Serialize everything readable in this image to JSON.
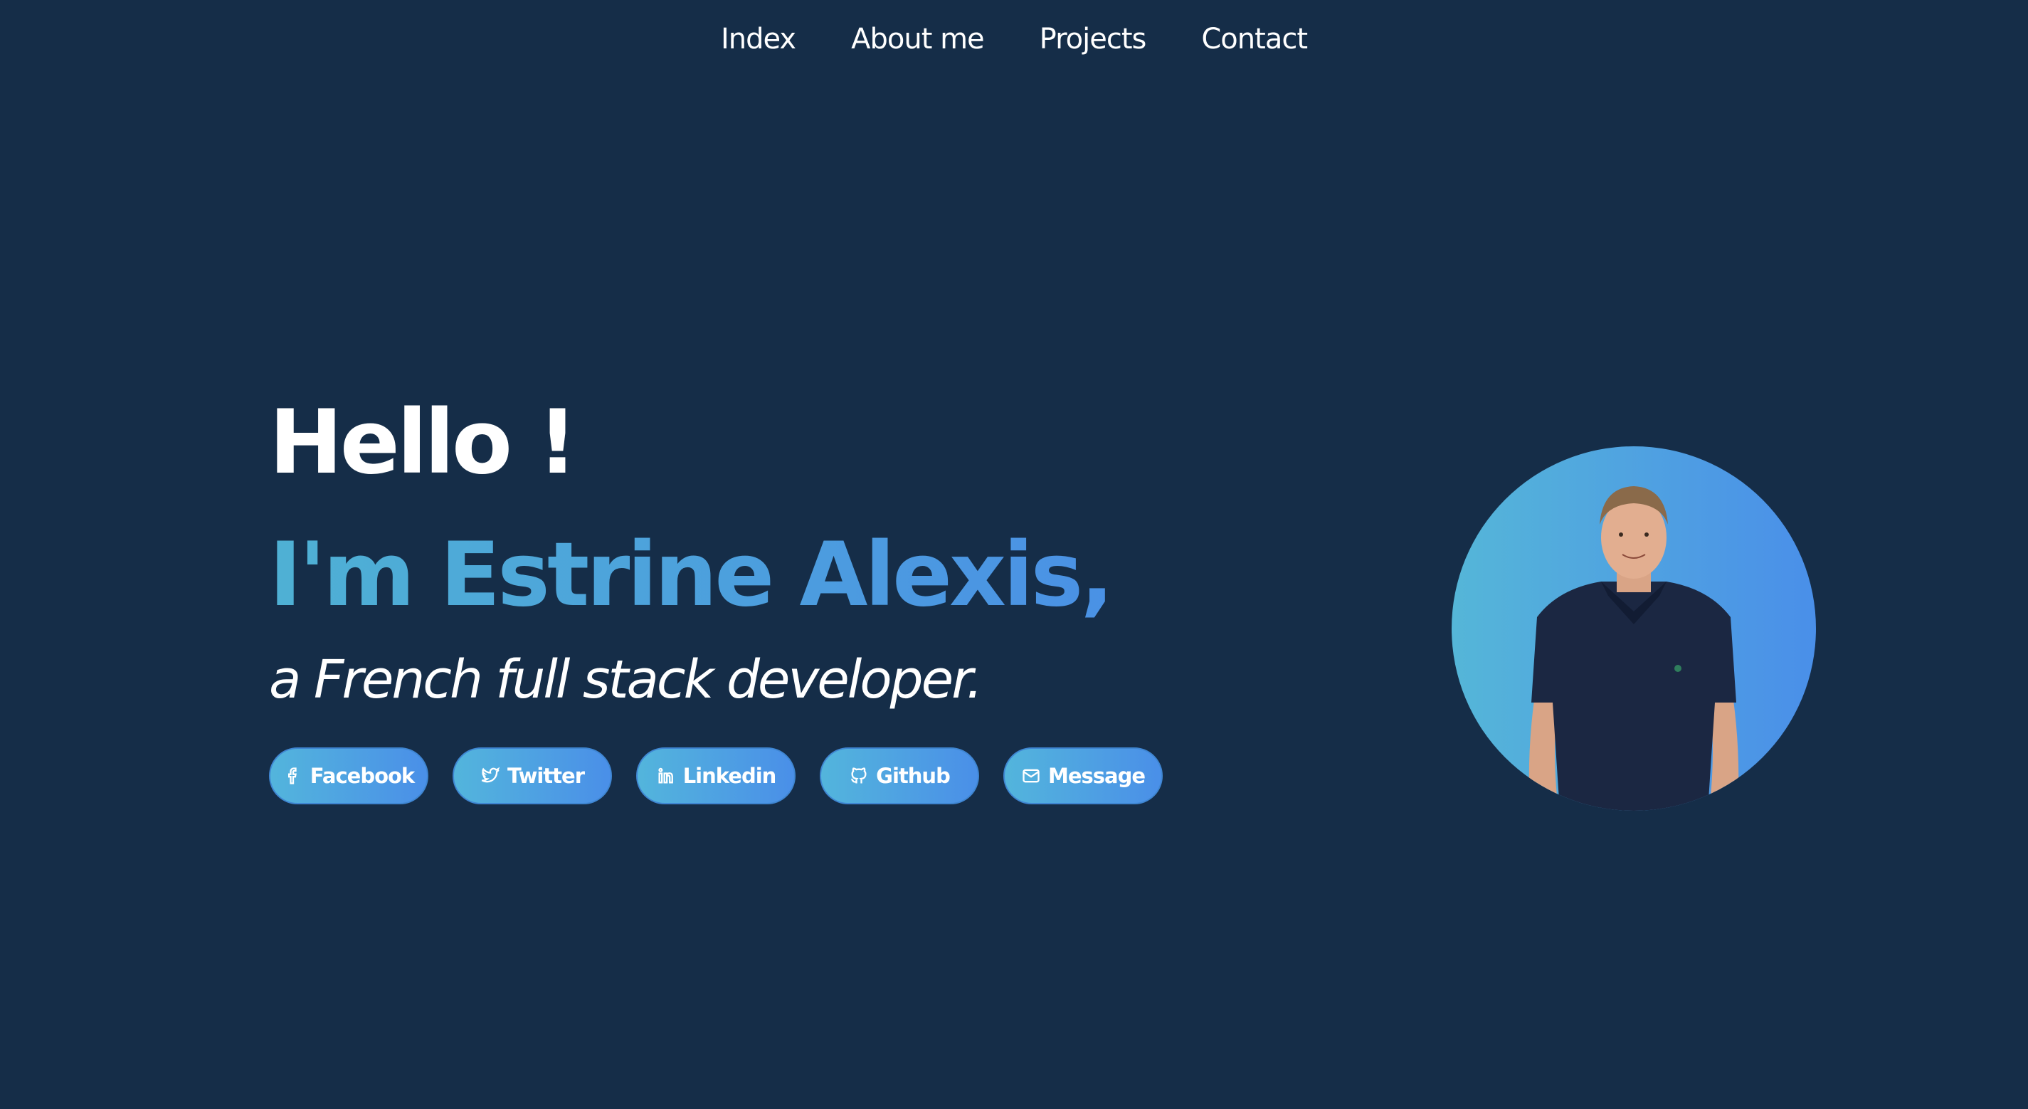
{
  "nav": {
    "items": [
      {
        "label": "Index"
      },
      {
        "label": "About me"
      },
      {
        "label": "Projects"
      },
      {
        "label": "Contact"
      }
    ]
  },
  "hero": {
    "greeting": "Hello !",
    "name": "I'm Estrine Alexis,",
    "role": "a French full stack developer."
  },
  "socials": [
    {
      "label": "Facebook",
      "icon": "facebook-icon"
    },
    {
      "label": "Twitter",
      "icon": "twitter-icon"
    },
    {
      "label": "Linkedin",
      "icon": "linkedin-icon"
    },
    {
      "label": "Github",
      "icon": "github-icon"
    },
    {
      "label": "Message",
      "icon": "mail-icon"
    }
  ],
  "colors": {
    "background": "#152d48",
    "accent_start": "#4fb1d4",
    "accent_end": "#4a8fe6",
    "shirt": "#1b2742"
  }
}
